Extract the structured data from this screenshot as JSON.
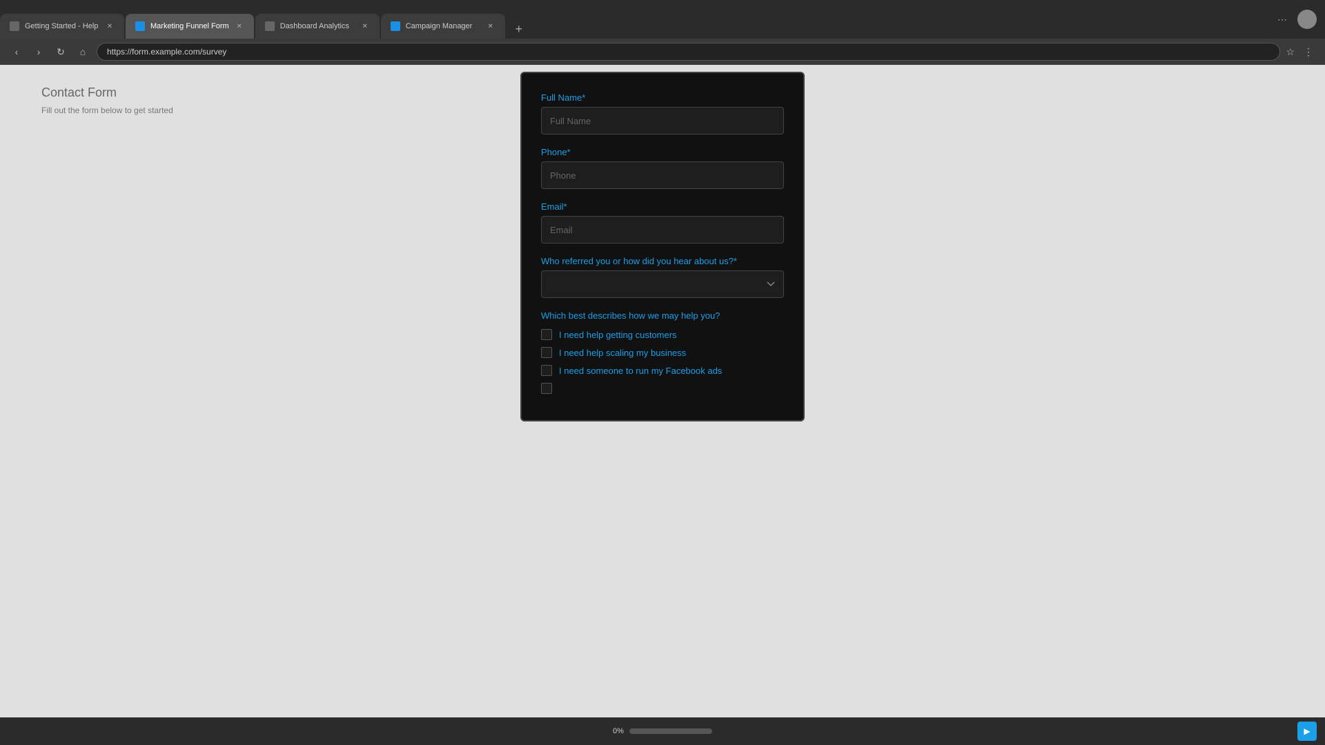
{
  "browser": {
    "tabs": [
      {
        "id": "tab-1",
        "favicon_color": "#888",
        "title": "Getting Started - Help",
        "active": false
      },
      {
        "id": "tab-2",
        "favicon_color": "#1a9fe8",
        "title": "Marketing Funnel Form",
        "active": true
      },
      {
        "id": "tab-3",
        "favicon_color": "#888",
        "title": "Dashboard Analytics",
        "active": false
      },
      {
        "id": "tab-4",
        "favicon_color": "#1a9fe8",
        "title": "Campaign Manager",
        "active": false
      }
    ],
    "add_tab_label": "+",
    "address": "https://form.example.com/survey"
  },
  "nav": {
    "back": "‹",
    "forward": "›",
    "reload": "↻",
    "home": "⌂"
  },
  "form": {
    "full_name_label": "Full Name",
    "full_name_required": "*",
    "full_name_placeholder": "Full Name",
    "phone_label": "Phone",
    "phone_required": "*",
    "phone_placeholder": "Phone",
    "email_label": "Email",
    "email_required": "*",
    "email_placeholder": "Email",
    "referral_label": "Who referred you or how did you hear about us?",
    "referral_required": "*",
    "referral_placeholder": "",
    "help_question": "Which best describes how we may help you?",
    "checkboxes": [
      {
        "id": "cb1",
        "label": "I need help getting customers",
        "checked": false
      },
      {
        "id": "cb2",
        "label": "I need help scaling my business",
        "checked": false
      },
      {
        "id": "cb3",
        "label": "I need someone to run my Facebook ads",
        "checked": false
      },
      {
        "id": "cb4",
        "label": "",
        "checked": false
      }
    ]
  },
  "progress": {
    "label": "0%",
    "percent": 0
  },
  "play_button_icon": "▶"
}
